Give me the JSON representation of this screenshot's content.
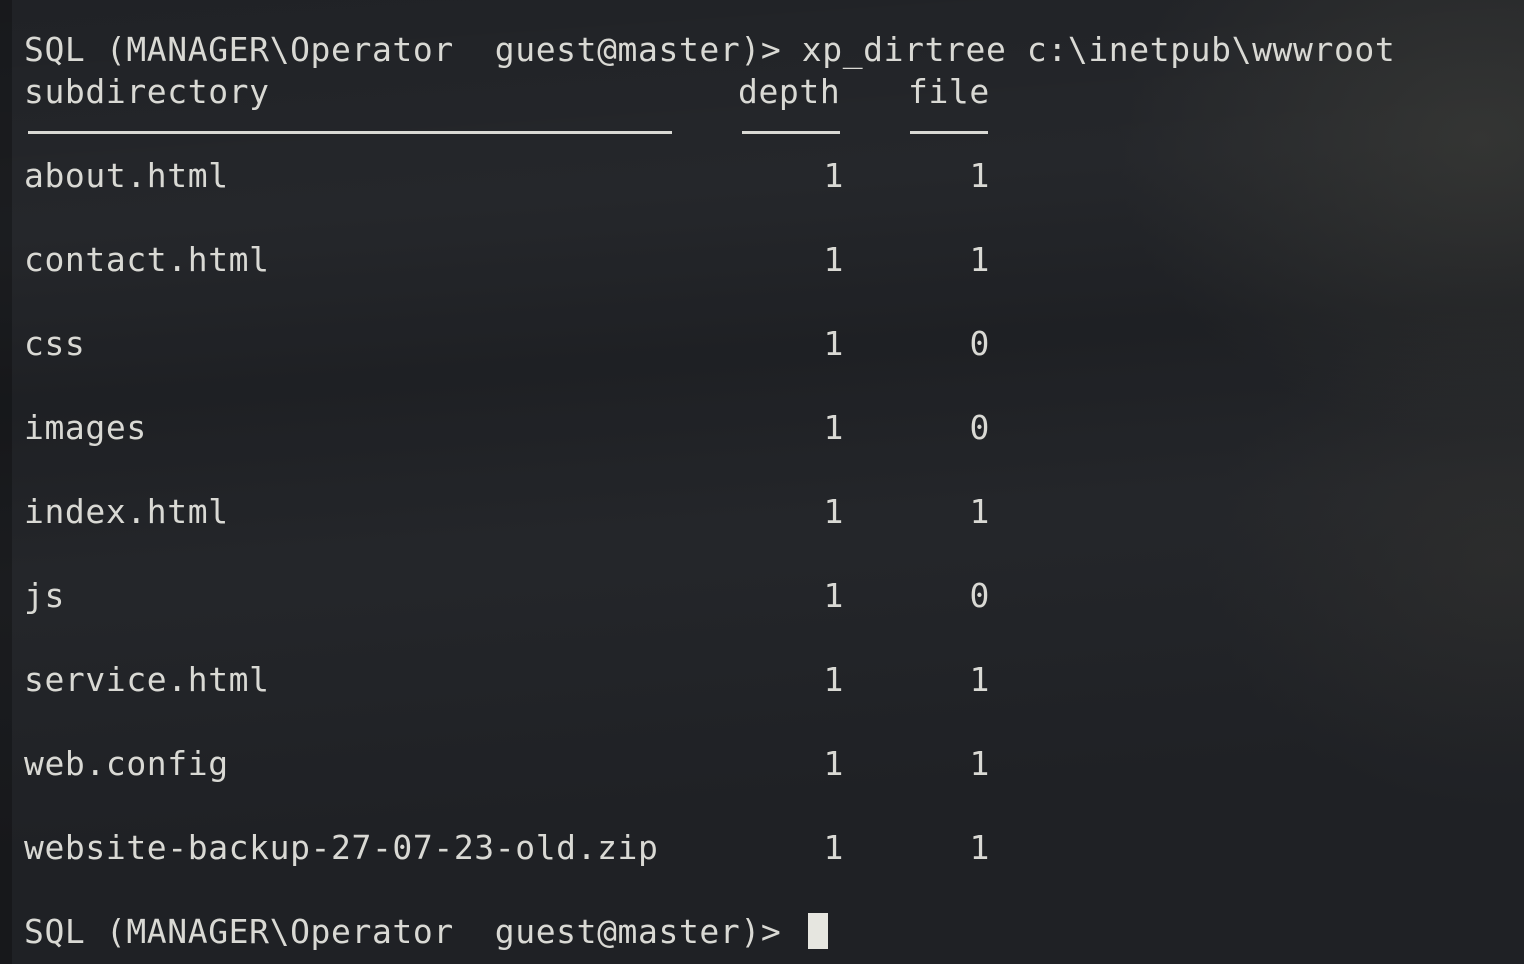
{
  "terminal": {
    "prompt_1": {
      "prompt": "SQL (MANAGER\\Operator  guest@master)> ",
      "command": "xp_dirtree c:\\inetpub\\wwwroot"
    },
    "headers": {
      "subdirectory": "subdirectory",
      "depth": "depth",
      "file": "file"
    },
    "rows": [
      {
        "subdirectory": "about.html",
        "depth": "1",
        "file": "1"
      },
      {
        "subdirectory": "contact.html",
        "depth": "1",
        "file": "1"
      },
      {
        "subdirectory": "css",
        "depth": "1",
        "file": "0"
      },
      {
        "subdirectory": "images",
        "depth": "1",
        "file": "0"
      },
      {
        "subdirectory": "index.html",
        "depth": "1",
        "file": "1"
      },
      {
        "subdirectory": "js",
        "depth": "1",
        "file": "0"
      },
      {
        "subdirectory": "service.html",
        "depth": "1",
        "file": "1"
      },
      {
        "subdirectory": "web.config",
        "depth": "1",
        "file": "1"
      },
      {
        "subdirectory": "website-backup-27-07-23-old.zip",
        "depth": "1",
        "file": "1"
      }
    ],
    "prompt_2": {
      "prompt": "SQL (MANAGER\\Operator  guest@master)> "
    }
  },
  "colors": {
    "background": "#202226",
    "text": "#d9d9d4",
    "cursor": "#e6e6e0"
  }
}
